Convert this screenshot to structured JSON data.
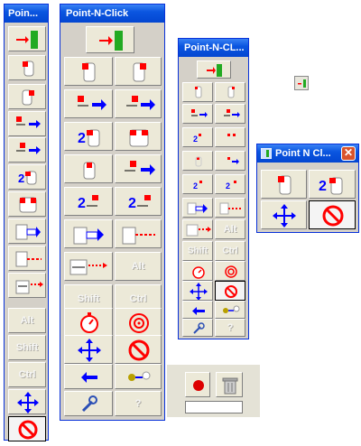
{
  "windows": {
    "w1": {
      "title": "Poin..."
    },
    "w2": {
      "title": "Point-N-Click"
    },
    "w3": {
      "title": "Point-N-CL..."
    },
    "w4": {
      "title": "Point N Cl...",
      "close": "✕"
    }
  },
  "keys": {
    "alt": "Alt",
    "shift": "Shift",
    "ctrl": "Ctrl",
    "help": "?",
    "double": "2"
  },
  "colors": {
    "accent": "#ff0000",
    "arrow": "#0000ff",
    "exit_green": "#22aa22",
    "titlebar": "#0b56e0"
  }
}
